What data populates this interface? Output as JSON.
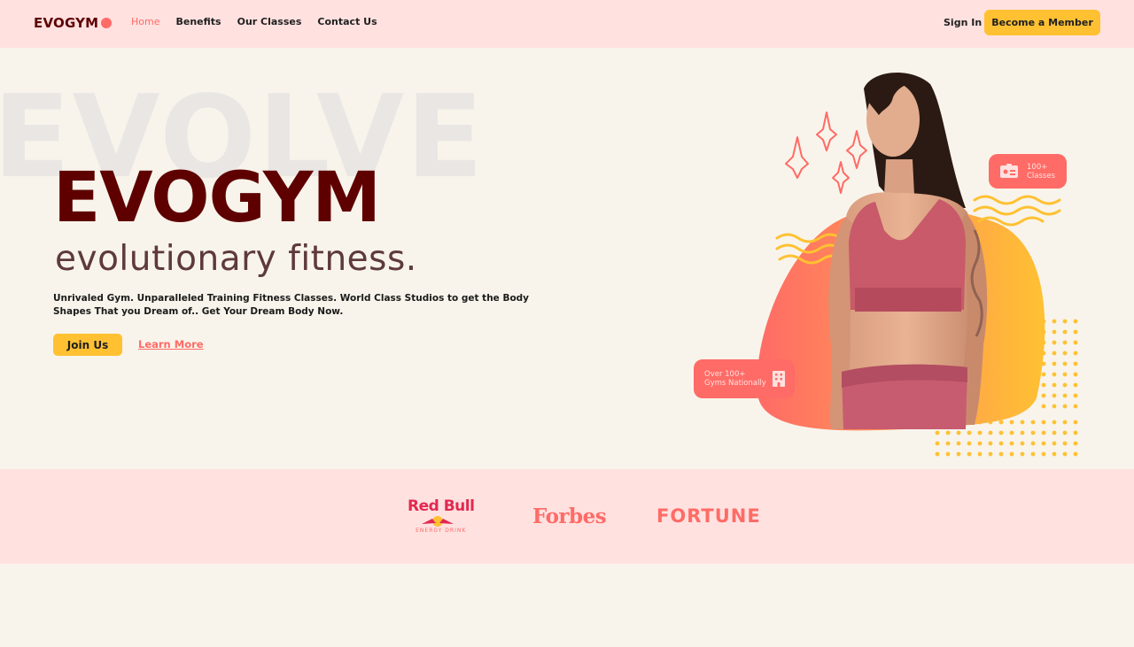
{
  "nav": {
    "logo": "EVOGYM",
    "links": [
      {
        "label": "Home"
      },
      {
        "label": "Benefits"
      },
      {
        "label": "Our Classes"
      },
      {
        "label": "Contact Us"
      }
    ],
    "sign_in": "Sign In",
    "cta": "Become a Member"
  },
  "hero": {
    "background_word": "EVOLVE",
    "title": "EVOGYM",
    "subtitle": "evolutionary fitness.",
    "description": "Unrivaled Gym. Unparalleled Training Fitness Classes. World Class Studios to get the Body Shapes That you Dream of.. Get Your Dream Body Now.",
    "join_label": "Join Us",
    "learn_more_label": "Learn More"
  },
  "badges": {
    "classes": {
      "line1": "100+",
      "line2": "Classes",
      "icon": "id-card-icon"
    },
    "gyms": {
      "line1": "Over 100+",
      "line2": "Gyms Nationally",
      "icon": "building-icon"
    }
  },
  "sponsors": {
    "redbull": {
      "name": "Red Bull",
      "sub": "ENERGY DRINK"
    },
    "forbes": "Forbes",
    "fortune": "FORTUNE"
  },
  "colors": {
    "primary": "#ff6b66",
    "secondary": "#ffc132",
    "dark": "#5e0000",
    "nav_bg": "#ffe1e0",
    "page_bg": "#f8f4eb"
  }
}
